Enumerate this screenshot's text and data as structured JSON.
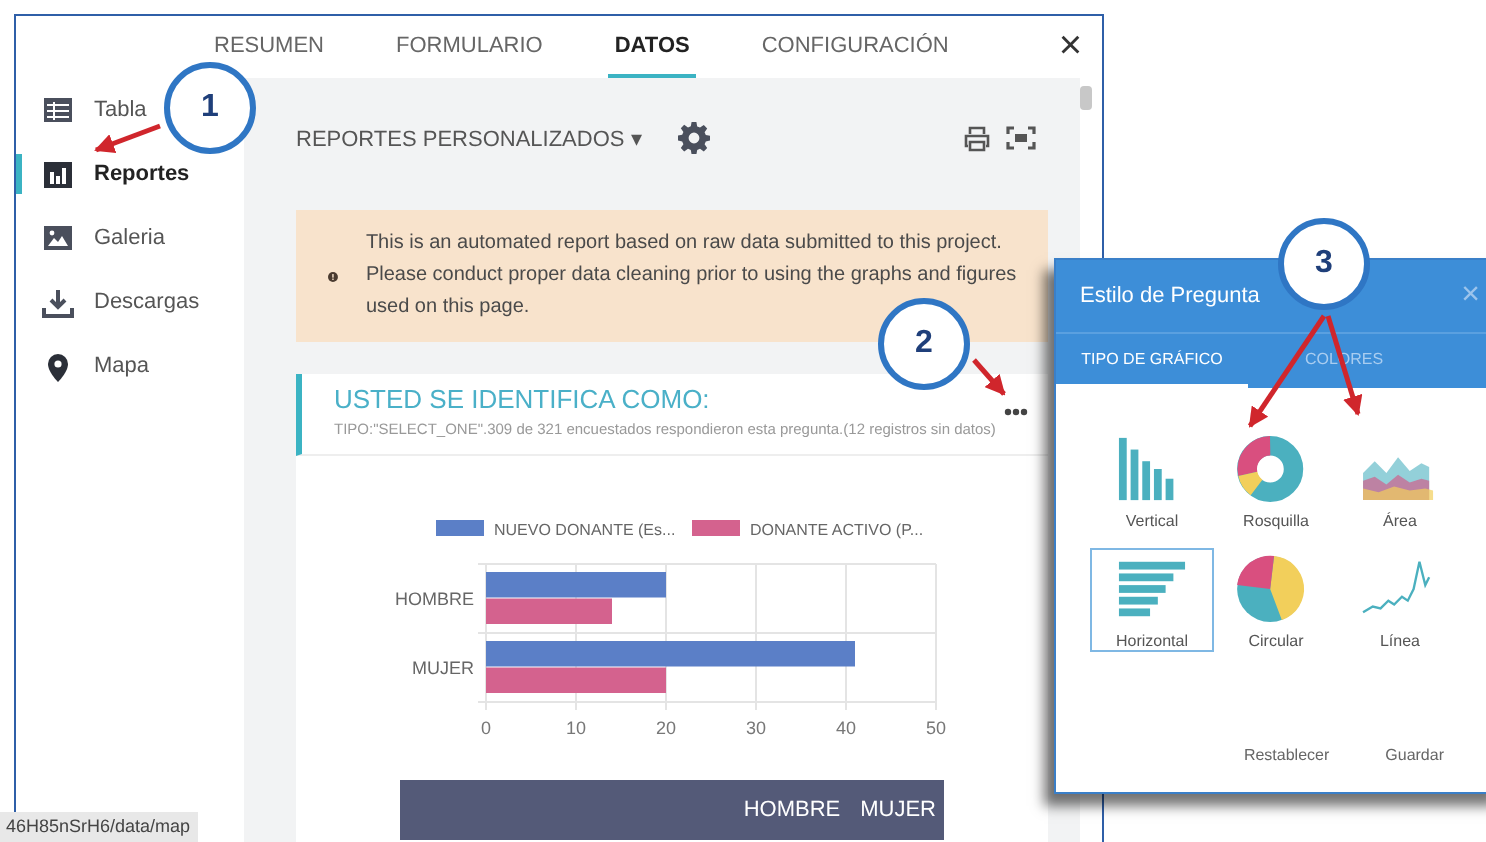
{
  "window": {
    "tabs": [
      {
        "label": "RESUMEN",
        "selected": false
      },
      {
        "label": "FORMULARIO",
        "selected": false
      },
      {
        "label": "DATOS",
        "selected": true
      },
      {
        "label": "CONFIGURACIÓN",
        "selected": false
      }
    ],
    "close": "×"
  },
  "sidebar": {
    "items": [
      {
        "label": "Tabla",
        "kind": "table",
        "selected": false
      },
      {
        "label": "Reportes",
        "kind": "bars",
        "selected": true
      },
      {
        "label": "Galeria",
        "kind": "image",
        "selected": false
      },
      {
        "label": "Descargas",
        "kind": "download",
        "selected": false
      },
      {
        "label": "Mapa",
        "kind": "pin",
        "selected": false
      }
    ]
  },
  "toolbar": {
    "report_menu": "REPORTES PERSONALIZADOS",
    "caret": "▾"
  },
  "alert": {
    "text": "This is an automated report based on raw data submitted to this project. Please conduct proper data cleaning prior to using the graphs and figures used on this page."
  },
  "report": {
    "title": "USTED SE IDENTIFICA COMO:",
    "subtitle": "TIPO:\"SELECT_ONE\".309 de 321 encuestados respondieron esta pregunta.(12 registros sin datos)",
    "chart_data": {
      "type": "bar",
      "orientation": "horizontal",
      "grid": true,
      "legend": true,
      "categories": [
        "HOMBRE",
        "MUJER"
      ],
      "xlim": [
        0,
        50
      ],
      "xticks": [
        0,
        10,
        20,
        30,
        40,
        50
      ],
      "series": [
        {
          "name": "NUEVO DONANTE (Es...",
          "color": "#5b7fc7",
          "values": [
            20,
            41
          ]
        },
        {
          "name": "DONANTE ACTIVO (P...",
          "color": "#d4628e",
          "values": [
            14,
            20
          ]
        }
      ]
    },
    "table": {
      "columns": [
        "HOMBRE",
        "MUJER"
      ]
    }
  },
  "dialog": {
    "title": "Estilo de Pregunta",
    "close": "×",
    "tabs": [
      {
        "label": "TIPO DE GRÁFICO",
        "selected": true
      },
      {
        "label": "COLORES",
        "selected": false
      }
    ],
    "chart_types": [
      {
        "label": "Vertical",
        "kind": "vertical",
        "selected": false
      },
      {
        "label": "Rosquilla",
        "kind": "donut",
        "selected": false
      },
      {
        "label": "Área",
        "kind": "area",
        "selected": false
      },
      {
        "label": "Horizontal",
        "kind": "horizontal",
        "selected": true
      },
      {
        "label": "Circular",
        "kind": "pie",
        "selected": false
      },
      {
        "label": "Línea",
        "kind": "line",
        "selected": false
      }
    ],
    "buttons": [
      "Restablecer",
      "Guardar"
    ]
  },
  "annotations": [
    {
      "label": "1"
    },
    {
      "label": "2"
    },
    {
      "label": "3"
    }
  ],
  "status_bar": {
    "url": "46H85nSrH6/data/map"
  }
}
